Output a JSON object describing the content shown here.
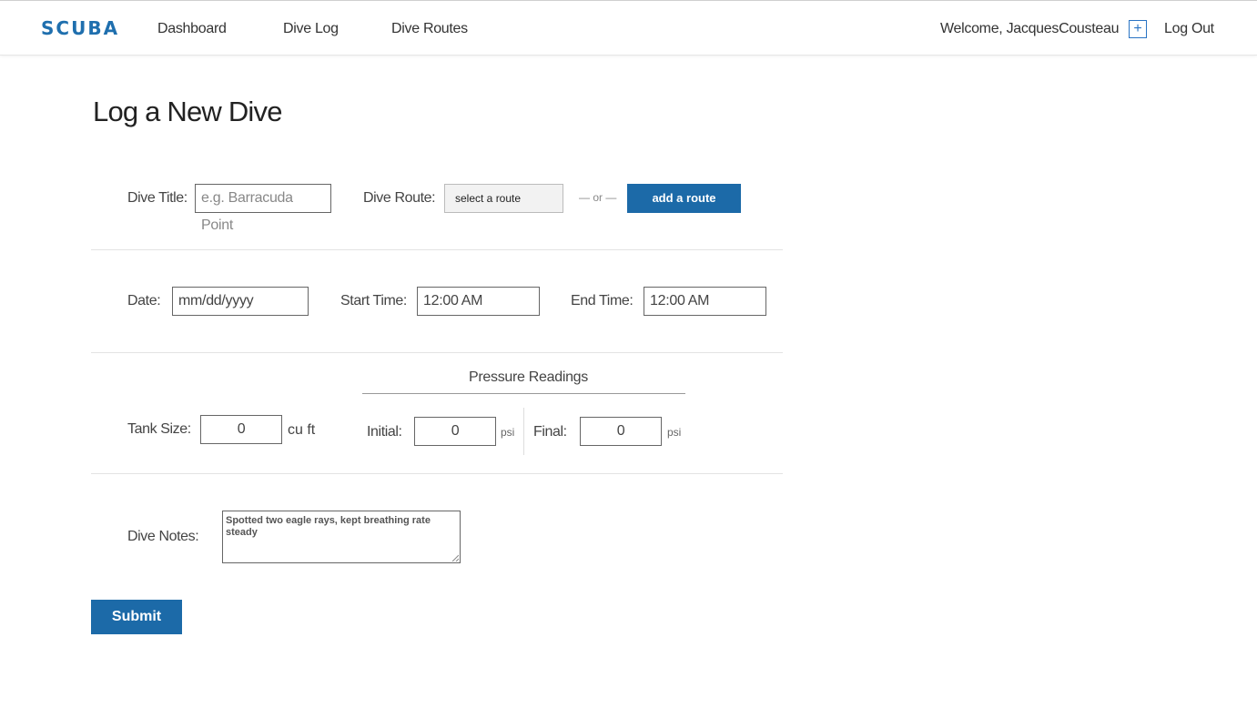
{
  "header": {
    "logo": "SCUBA",
    "nav": [
      "Dashboard",
      "Dive Log",
      "Dive Routes"
    ],
    "welcome": "Welcome, JacquesCousteau",
    "add_icon": "plus-square-icon",
    "logout": "Log Out"
  },
  "page": {
    "title": "Log a New Dive"
  },
  "form": {
    "dive_title": {
      "label": "Dive Title:",
      "placeholder": "e.g. Barracuda Point"
    },
    "dive_route": {
      "label": "Dive Route:",
      "selected": "select a route",
      "or": "— or —",
      "add_button": "add a route"
    },
    "date": {
      "label": "Date:",
      "placeholder": "mm/dd/yyyy"
    },
    "start_time": {
      "label": "Start Time:",
      "value": "12:00 AM"
    },
    "end_time": {
      "label": "End Time:",
      "value": "12:00 AM"
    },
    "pressure_title": "Pressure Readings",
    "tank_size": {
      "label": "Tank Size:",
      "value": "0",
      "unit": "cu ft"
    },
    "initial": {
      "label": "Initial:",
      "value": "0",
      "unit": "psi"
    },
    "final": {
      "label": "Final:",
      "value": "0",
      "unit": "psi"
    },
    "notes": {
      "label": "Dive Notes:",
      "value": "Spotted two eagle rays, kept breathing rate steady"
    },
    "submit": "Submit"
  },
  "colors": {
    "brand": "#1f6fae",
    "button": "#1c6aa8"
  }
}
